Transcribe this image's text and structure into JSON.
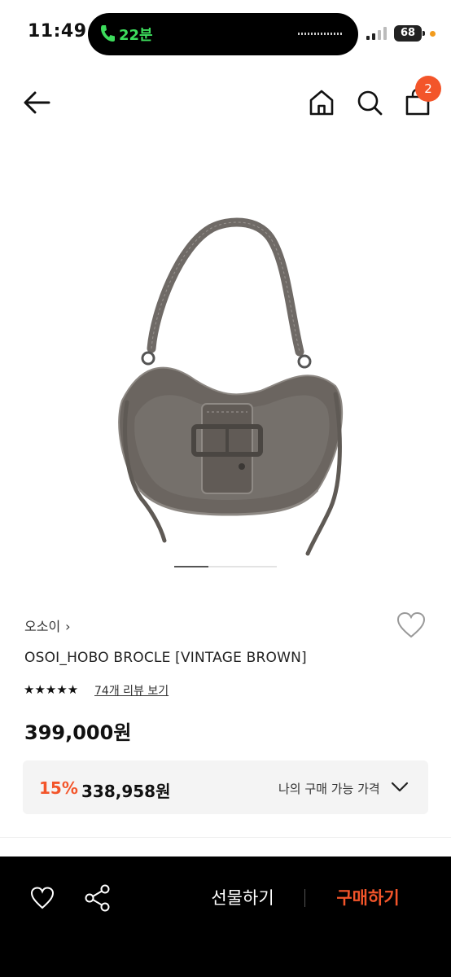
{
  "status_bar": {
    "time": "11:49",
    "call_text": "22분",
    "battery": "68"
  },
  "header": {
    "cart_count": "2",
    "icons": [
      "back-arrow-icon",
      "home-icon",
      "search-icon",
      "shopping-bag-icon"
    ]
  },
  "gallery": {
    "current_index": 1,
    "total": 3
  },
  "product": {
    "brand": "오소이",
    "brand_chevron": "›",
    "name": "OSOI_HOBO BROCLE [VINTAGE BROWN]",
    "rating_stars": "★★★★★",
    "rating": 5,
    "review_link": "74개 리뷰 보기",
    "price": "399,000원",
    "discount_rate": "15%",
    "discount_price": "338,958원",
    "my_price_label": "나의 구매 가능 가격"
  },
  "bottom_bar": {
    "gift_label": "선물하기",
    "buy_label": "구매하기"
  },
  "colors": {
    "accent": "#f3552a",
    "call_green": "#3ddc5c",
    "bottom_bar": "#000000",
    "price_box_bg": "#f4f4f4"
  }
}
